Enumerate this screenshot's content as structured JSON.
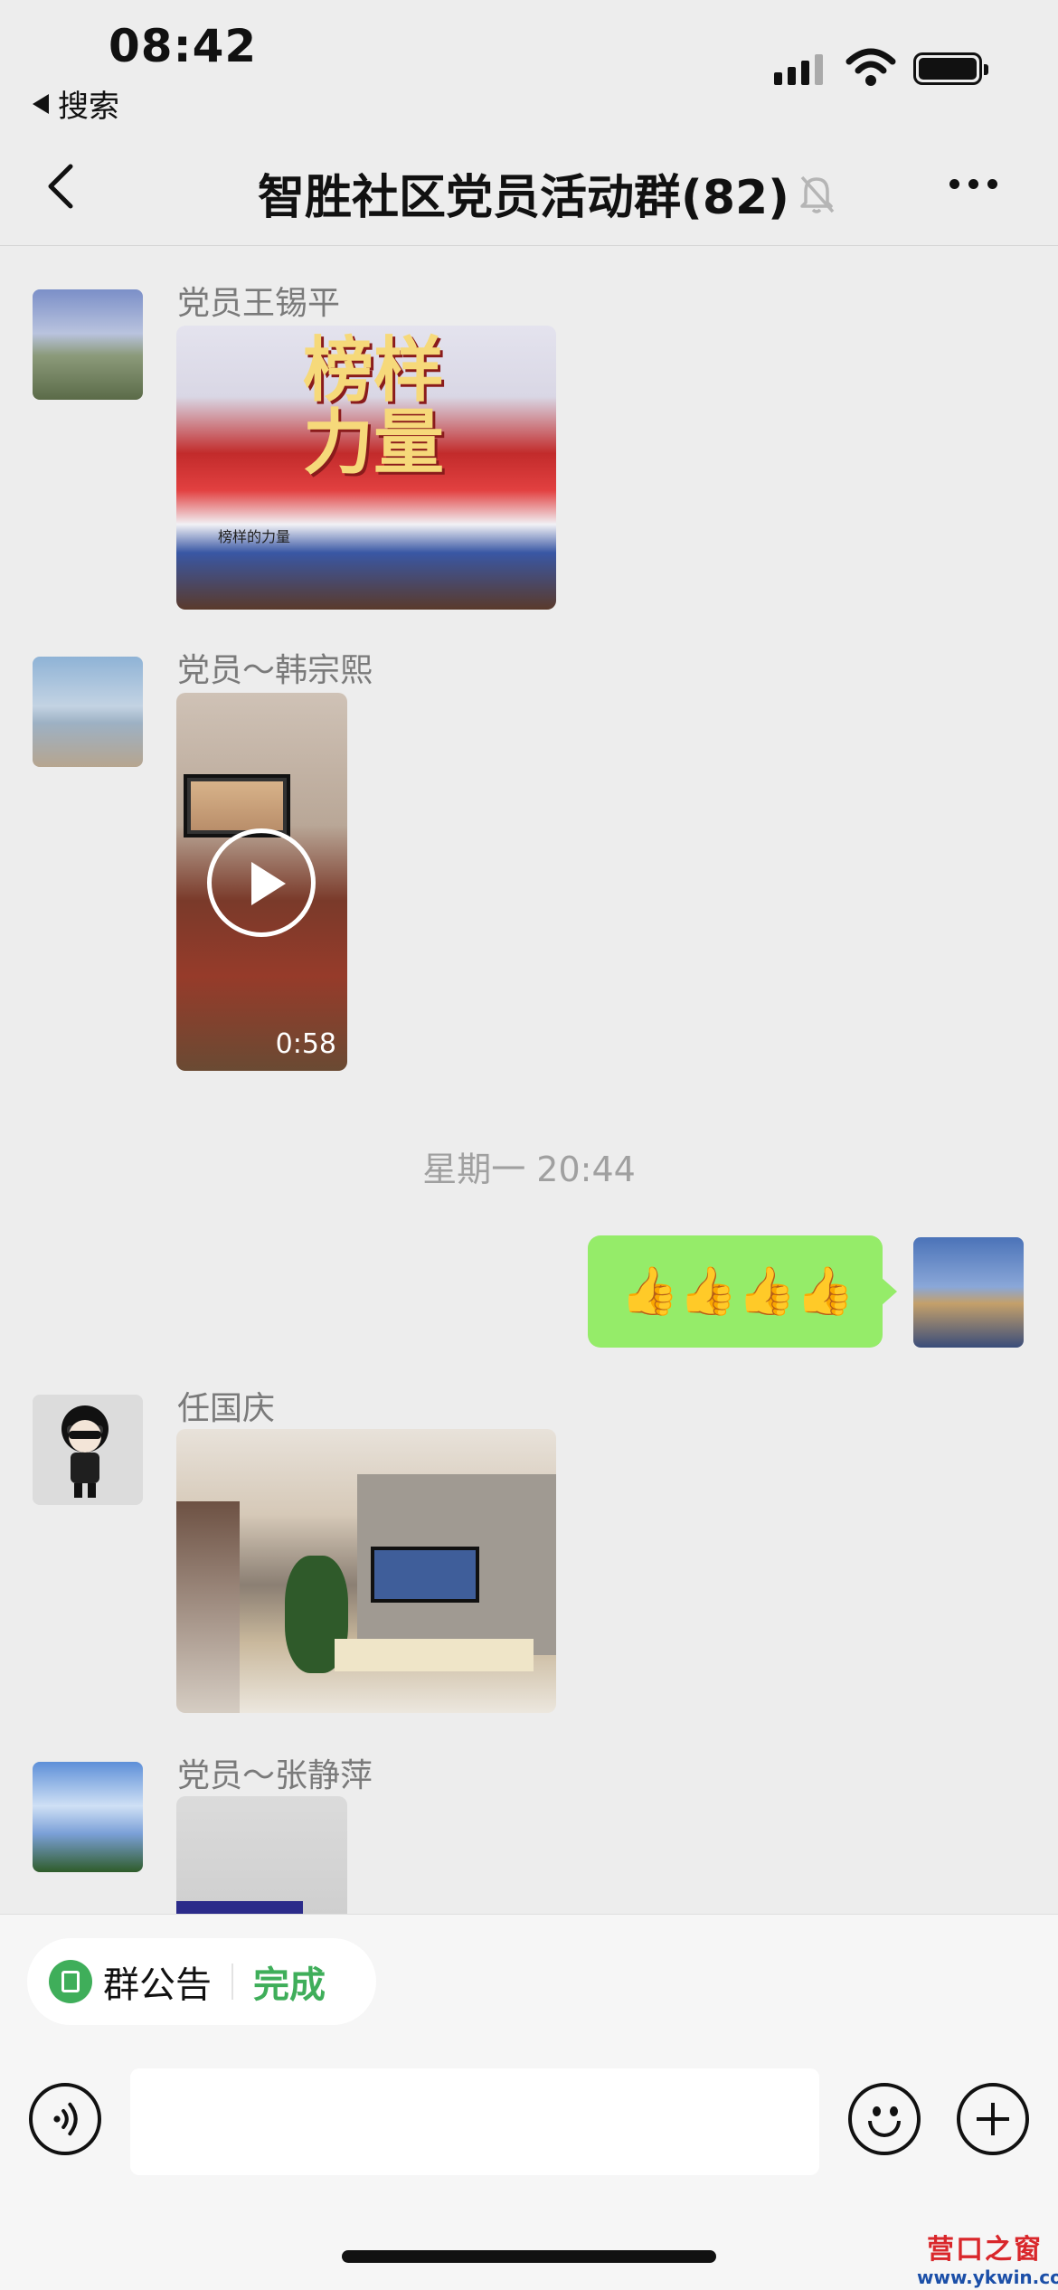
{
  "status_bar": {
    "time": "08:42",
    "back_app": "搜索"
  },
  "nav": {
    "title": "智胜社区党员活动群(82)",
    "muted_icon": "bell-slash-icon",
    "more_icon": "more-dots-icon",
    "back_icon": "chevron-left-icon"
  },
  "messages": [
    {
      "sender": "党员王锡平",
      "type": "image",
      "image_caption": "榜样的力量",
      "image_title": "榜样力量"
    },
    {
      "sender": "党员～韩宗熙",
      "type": "video",
      "duration": "0:58"
    },
    {
      "sender": "",
      "type": "emoji-text",
      "text": "👍👍👍👍",
      "from_me": true
    },
    {
      "sender": "任国庆",
      "type": "image"
    },
    {
      "sender": "党员～张静萍",
      "type": "image"
    }
  ],
  "timestamp": "星期一 20:44",
  "bottom": {
    "notice_label": "群公告",
    "done_label": "完成",
    "voice_icon": "voice-icon",
    "emoji_icon": "emoji-icon",
    "plus_icon": "plus-icon"
  },
  "watermark": {
    "line1": "营口之窗",
    "line2": "www.ykwin.com"
  },
  "colors": {
    "background": "#ededed",
    "bubble_me": "#95ec69",
    "accent_green": "#3fae5a"
  }
}
